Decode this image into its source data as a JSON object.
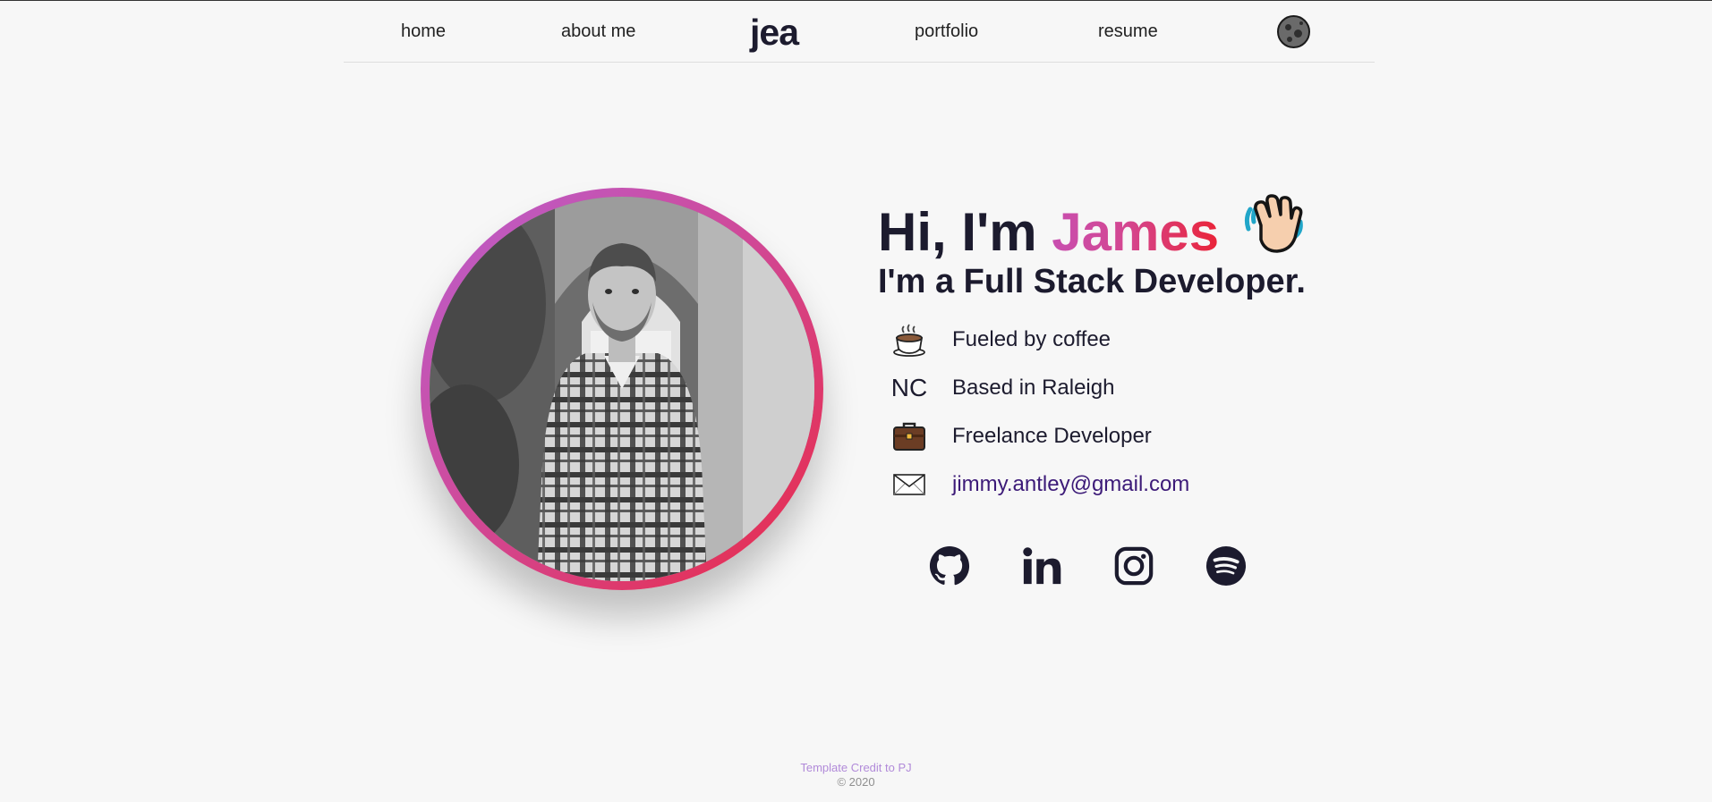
{
  "nav": {
    "home": "home",
    "about": "about me",
    "logo": "jea",
    "portfolio": "portfolio",
    "resume": "resume"
  },
  "hero": {
    "greeting_prefix": "Hi, I'm ",
    "name": "James",
    "subtitle": "I'm a Full Stack Developer."
  },
  "facts": [
    {
      "icon": "coffee-icon",
      "text": "Fueled by coffee"
    },
    {
      "icon": "NC",
      "text": "Based in Raleigh"
    },
    {
      "icon": "briefcase-icon",
      "text": "Freelance Developer"
    },
    {
      "icon": "envelope-icon",
      "text": "jimmy.antley@gmail.com"
    }
  ],
  "socials": [
    "github-icon",
    "linkedin-icon",
    "instagram-icon",
    "spotify-icon"
  ],
  "footer": {
    "credit": "Template Credit to PJ",
    "copyright": "© 2020"
  },
  "colors": {
    "background": "#f7f7f7",
    "text": "#1c1b2e",
    "gradient_start": "#c84fb0",
    "gradient_end": "#ea2438",
    "email_link": "#3c1a78",
    "credit_link": "#b18ad9"
  }
}
